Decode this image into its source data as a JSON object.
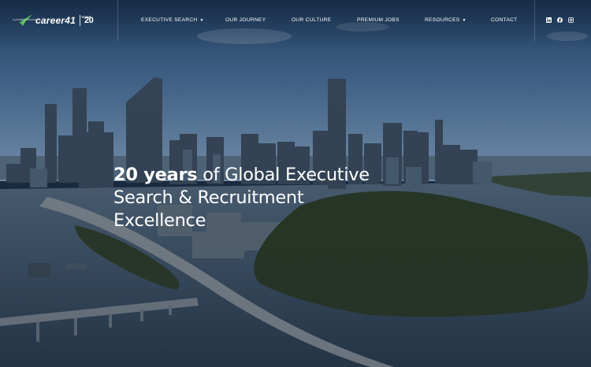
{
  "brand": {
    "name": "career41",
    "tagline": "a positive impact",
    "years_badge": "20",
    "years_badge_sub": "YEARS"
  },
  "nav": {
    "items": [
      {
        "label": "EXECUTIVE SEARCH",
        "has_dropdown": true
      },
      {
        "label": "OUR JOURNEY",
        "has_dropdown": false
      },
      {
        "label": "OUR CULTURE",
        "has_dropdown": false
      },
      {
        "label": "PREMIUM JOBS",
        "has_dropdown": false
      },
      {
        "label": "RESOURCES",
        "has_dropdown": true
      },
      {
        "label": "CONTACT",
        "has_dropdown": false
      }
    ]
  },
  "social": {
    "icons": [
      "linkedin-icon",
      "facebook-icon",
      "instagram-icon"
    ]
  },
  "hero": {
    "headline_strong": "20 years",
    "headline_rest_1": " of Global Executive",
    "headline_line_2": "Search & Recruitment",
    "headline_line_3": "Excellence"
  },
  "colors": {
    "sky_top": "#2f5784",
    "sky_bottom": "#7e9ec0",
    "river": "#3a4f63",
    "trees": "#2b3b24",
    "logo_green": "#5cc35b",
    "text": "#ffffff"
  }
}
